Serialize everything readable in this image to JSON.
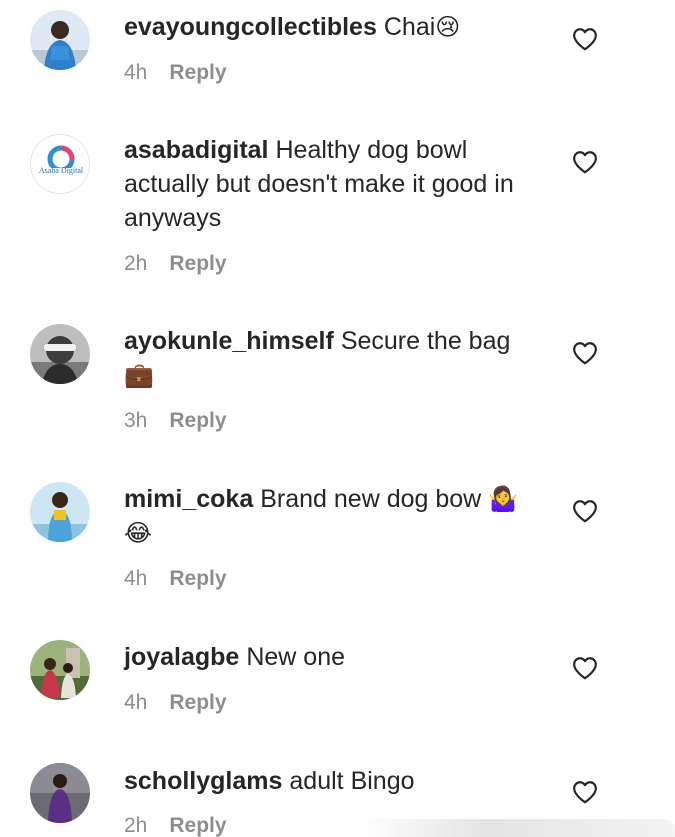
{
  "comments": [
    {
      "username": "evayoungcollectibles",
      "text": "Chai",
      "emoji": "😢",
      "time": "4h",
      "reply_label": "Reply",
      "like_icon": "heart-outline-icon"
    },
    {
      "username": "asabadigital",
      "text": "Healthy dog bowl actually but doesn't make it good in anyways",
      "emoji": "",
      "time": "2h",
      "reply_label": "Reply",
      "avatar_logo_text": "Asaba Digital",
      "like_icon": "heart-outline-icon"
    },
    {
      "username": "ayokunle_himself",
      "text": "Secure the bag",
      "emoji": "💼",
      "time": "3h",
      "reply_label": "Reply",
      "like_icon": "heart-outline-icon"
    },
    {
      "username": "mimi_coka",
      "text": "Brand new dog bow",
      "emoji": "🤷‍♀️ 😂",
      "time": "4h",
      "reply_label": "Reply",
      "like_icon": "heart-outline-icon"
    },
    {
      "username": "joyalagbe",
      "text": "New one",
      "emoji": "",
      "time": "4h",
      "reply_label": "Reply",
      "like_icon": "heart-outline-icon"
    },
    {
      "username": "schollyglams",
      "text": "adult Bingo",
      "emoji": "",
      "time": "2h",
      "reply_label": "Reply",
      "like_icon": "heart-outline-icon"
    }
  ],
  "colors": {
    "text": "#262626",
    "meta": "#8e8e8e",
    "background": "#ffffff"
  }
}
